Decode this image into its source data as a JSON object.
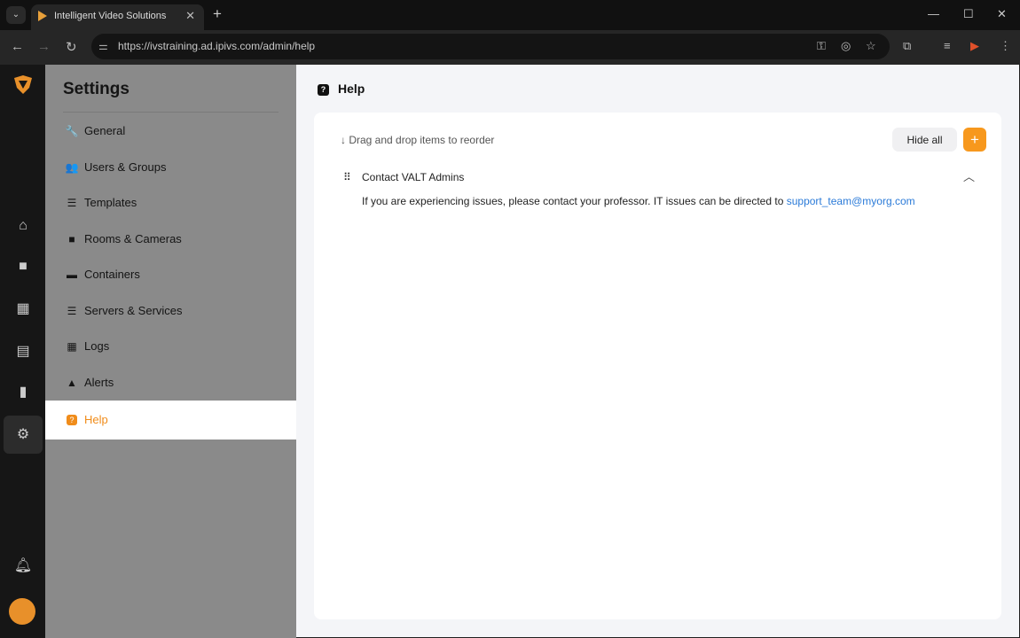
{
  "browser": {
    "tab_title": "Intelligent Video Solutions",
    "url": "https://ivstraining.ad.ipivs.com/admin/help"
  },
  "settings": {
    "title": "Settings",
    "items": [
      {
        "label": "General",
        "icon": "wrench-icon",
        "glyph": "🔧"
      },
      {
        "label": "Users & Groups",
        "icon": "users-icon",
        "glyph": "👥"
      },
      {
        "label": "Templates",
        "icon": "list-icon",
        "glyph": "☰"
      },
      {
        "label": "Rooms & Cameras",
        "icon": "camera-icon",
        "glyph": "■"
      },
      {
        "label": "Containers",
        "icon": "archive-icon",
        "glyph": "▬"
      },
      {
        "label": "Servers & Services",
        "icon": "server-icon",
        "glyph": "☰"
      },
      {
        "label": "Logs",
        "icon": "calendar-icon",
        "glyph": "▦"
      },
      {
        "label": "Alerts",
        "icon": "warning-icon",
        "glyph": "▲"
      },
      {
        "label": "Help",
        "icon": "question-icon",
        "glyph": "?",
        "active": true
      }
    ]
  },
  "main": {
    "title": "Help",
    "hint": "↓ Drag and drop items to reorder",
    "hide_all": "Hide all",
    "add": "+",
    "items": [
      {
        "title": "Contact VALT Admins",
        "body": "If you are experiencing issues, please contact your professor. IT issues can be directed to ",
        "link": "support_team@myorg.com"
      }
    ]
  },
  "colors": {
    "accent": "#f7981d",
    "link": "#2a7ad8"
  }
}
